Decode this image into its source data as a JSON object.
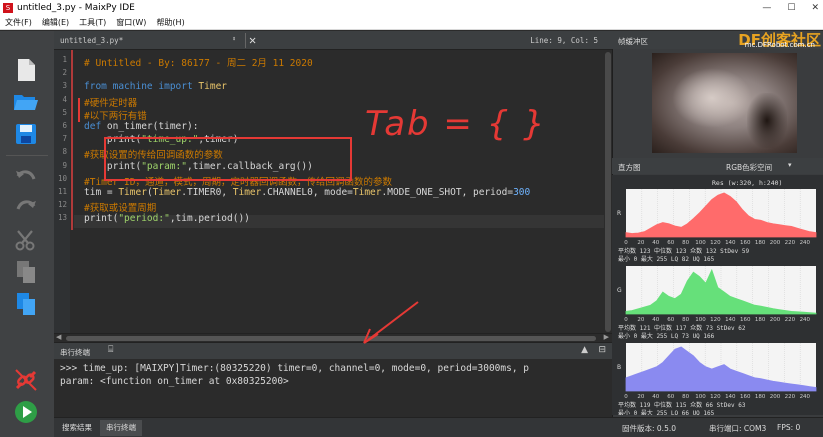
{
  "window": {
    "title": "untitled_3.py - MaixPy IDE",
    "app_icon": "S"
  },
  "menu": [
    "文件(F)",
    "编辑(E)",
    "工具(T)",
    "窗口(W)",
    "帮助(H)"
  ],
  "editor": {
    "filename": "untitled_3.py*",
    "cursor_pos": "Line: 9, Col: 5",
    "line_numbers": [
      "1",
      "2",
      "3",
      "4",
      "5",
      "6",
      "7",
      "8",
      "9",
      "10",
      "11",
      "12",
      "13"
    ],
    "lines": [
      [
        {
          "t": "# Untitled - By: 86177 - 周二 2月 11 2020",
          "c": "cm"
        }
      ],
      [],
      [
        {
          "t": "from ",
          "c": "kw"
        },
        {
          "t": "machine ",
          "c": "kw"
        },
        {
          "t": "import ",
          "c": "kw"
        },
        {
          "t": "Timer",
          "c": "cls"
        }
      ],
      [
        {
          "t": "#硬件定时器",
          "c": "cm"
        }
      ],
      [
        {
          "t": "#以下两行有错",
          "c": "cm"
        }
      ],
      [
        {
          "t": "def ",
          "c": "kw"
        },
        {
          "t": "on_timer",
          "c": "fn"
        },
        {
          "t": "(timer):",
          "c": "fn"
        }
      ],
      [
        {
          "t": "    print(",
          "c": "fn"
        },
        {
          "t": "\"time_up:\"",
          "c": "str"
        },
        {
          "t": ",timer)",
          "c": "fn"
        }
      ],
      [
        {
          "t": "#获取设置的传给回调函数的参数",
          "c": "cm"
        }
      ],
      [
        {
          "t": "    print(",
          "c": "fn"
        },
        {
          "t": "\"param:\"",
          "c": "str"
        },
        {
          "t": ",timer.callback_arg())",
          "c": "fn"
        }
      ],
      [
        {
          "t": "#Timer ID，通道，模式，周期，定时器回调函数，传给回调函数的参数",
          "c": "cm"
        }
      ],
      [
        {
          "t": "tim = ",
          "c": "fn"
        },
        {
          "t": "Timer",
          "c": "cls"
        },
        {
          "t": "(",
          "c": "fn"
        },
        {
          "t": "Timer",
          "c": "cls"
        },
        {
          "t": ".TIMER0, ",
          "c": "fn"
        },
        {
          "t": "Timer",
          "c": "cls"
        },
        {
          "t": ".CHANNEL0, mode=",
          "c": "fn"
        },
        {
          "t": "Timer",
          "c": "cls"
        },
        {
          "t": ".MODE_ONE_SHOT, period=",
          "c": "fn"
        },
        {
          "t": "300",
          "c": "num"
        }
      ],
      [
        {
          "t": "#获取或设置周期",
          "c": "cm"
        }
      ],
      [
        {
          "t": "print(",
          "c": "fn"
        },
        {
          "t": "\"period:\"",
          "c": "str"
        },
        {
          "t": ",tim.period())",
          "c": "fn"
        }
      ]
    ]
  },
  "annotation": {
    "text": "Tab = { }"
  },
  "terminal": {
    "tab_label": "串行终端",
    "lines": [
      ">>> time_up: [MAIXPY]Timer:(80325220) timer=0, channel=0, mode=0, period=3000ms, p",
      "param: <function on_timer at 0x80325200>"
    ]
  },
  "bottom": {
    "tabs": [
      "搜索结果",
      "串行终端"
    ],
    "firmware": "固件版本: 0.5.0",
    "serial_port": "串行端口: COM3",
    "fps": "FPS: 0"
  },
  "framebuffer": {
    "title": "帧缓冲区",
    "watermark": "DF创客社区",
    "watermark_url": "mc.DFRobot.com.cn"
  },
  "histogram": {
    "title": "直方图",
    "colorspace": "RGB色彩空间",
    "resolution": "Res (w:320, h:240)",
    "axis_ticks": [
      "0",
      "20",
      "40",
      "60",
      "80",
      "100",
      "120",
      "140",
      "160",
      "180",
      "200",
      "220",
      "240"
    ],
    "channels": [
      {
        "label": "R",
        "color": "#ff6b6b",
        "values": [
          0.1,
          0.08,
          0.09,
          0.12,
          0.2,
          0.28,
          0.33,
          0.3,
          0.25,
          0.22,
          0.3,
          0.42,
          0.55,
          0.7,
          0.85,
          0.95,
          1.0,
          0.92,
          0.8,
          0.62,
          0.48,
          0.4,
          0.38,
          0.33,
          0.3,
          0.28,
          0.26,
          0.24,
          0.2,
          0.16,
          0.12,
          0.1
        ],
        "stats": [
          "平均数 123   中位数 123   众数 132   StDev 59",
          "最小   0     最大   255   LQ   82    UQ   165"
        ]
      },
      {
        "label": "G",
        "color": "#66e07a",
        "values": [
          0.06,
          0.08,
          0.12,
          0.16,
          0.2,
          0.3,
          0.5,
          0.4,
          0.35,
          0.45,
          0.75,
          0.95,
          0.85,
          0.7,
          1.0,
          0.6,
          0.5,
          0.4,
          0.35,
          0.3,
          0.25,
          0.2,
          0.18,
          0.15,
          0.12,
          0.1,
          0.08,
          0.06,
          0.05,
          0.04,
          0.03,
          0.02
        ],
        "stats": [
          "平均数 121   中位数 117   众数 73    StDev 62",
          "最小   0     最大   255   LQ   73    UQ   166"
        ]
      },
      {
        "label": "B",
        "color": "#8a8af0",
        "values": [
          0.3,
          0.35,
          0.4,
          0.45,
          0.5,
          0.55,
          0.65,
          0.8,
          0.95,
          1.0,
          0.9,
          0.8,
          0.65,
          0.55,
          0.5,
          0.55,
          0.6,
          0.5,
          0.45,
          0.4,
          0.35,
          0.3,
          0.28,
          0.25,
          0.22,
          0.2,
          0.18,
          0.16,
          0.14,
          0.12,
          0.1,
          0.08
        ],
        "stats": [
          "平均数 119   中位数 115   众数 66    StDev 63",
          "最小   0     最大   255   LQ   66    UQ   165"
        ]
      }
    ]
  },
  "colors": {
    "accent_red": "#e53935",
    "comment": "#cc7a00",
    "keyword": "#4a8fd4",
    "string": "#9ed36a",
    "class": "#e8c46a"
  }
}
